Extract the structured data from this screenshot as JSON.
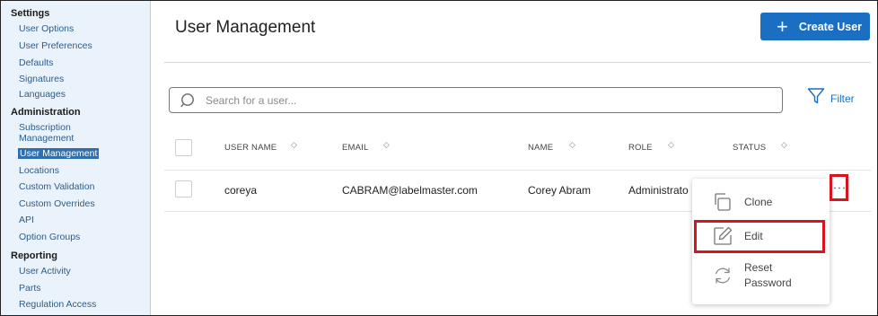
{
  "sidebar": {
    "sections": [
      {
        "title": "Settings",
        "items": [
          "User Options",
          "User Preferences",
          "Defaults",
          "Signatures",
          "Languages"
        ]
      },
      {
        "title": "Administration",
        "items": [
          "Subscription Management",
          "User Management",
          "Locations",
          "Custom Validation",
          "Custom Overrides",
          "API",
          "Option Groups"
        ]
      },
      {
        "title": "Reporting",
        "items": [
          "User Activity",
          "Parts",
          "Regulation Access"
        ]
      }
    ],
    "subscription_line1": "Subscription",
    "subscription_line2": "Management",
    "active_item": "User Management"
  },
  "page": {
    "title": "User Management",
    "create_button": "Create User"
  },
  "search": {
    "placeholder": "Search for a user...",
    "value": ""
  },
  "filter": {
    "label": "Filter"
  },
  "table": {
    "columns": [
      "USER NAME",
      "EMAIL",
      "NAME",
      "ROLE",
      "STATUS"
    ],
    "rows": [
      {
        "username": "coreya",
        "email": "CABRAM@labelmaster.com",
        "name": "Corey Abram",
        "role": "Administrato"
      }
    ]
  },
  "row_menu": {
    "items": [
      {
        "label": "Clone",
        "icon": "clone-icon"
      },
      {
        "label": "Edit",
        "icon": "edit-icon"
      },
      {
        "label_line1": "Reset",
        "label_line2": "Password",
        "icon": "refresh-icon"
      }
    ]
  },
  "colors": {
    "accent": "#1b6fc2",
    "highlight": "#d8141f",
    "sidebar_bg": "#eaf3fb",
    "sidebar_link": "#2c5c8a"
  }
}
